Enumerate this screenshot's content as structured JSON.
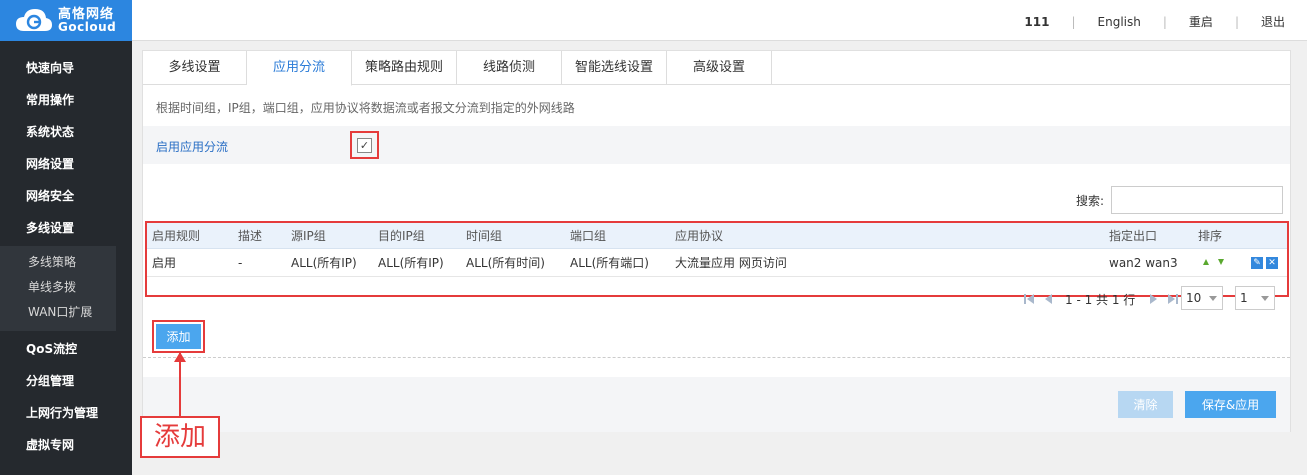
{
  "brand": {
    "name_cn": "高恪网络",
    "name_en": "Gocloud"
  },
  "topbar": {
    "user": "111",
    "language": "English",
    "reboot": "重启",
    "logout": "退出"
  },
  "sidebar": {
    "items": [
      {
        "label": "快速向导"
      },
      {
        "label": "常用操作"
      },
      {
        "label": "系统状态"
      },
      {
        "label": "网络设置"
      },
      {
        "label": "网络安全"
      },
      {
        "label": "多线设置"
      }
    ],
    "sub_items": [
      {
        "label": "多线策略"
      },
      {
        "label": "单线多拨"
      },
      {
        "label": "WAN口扩展"
      }
    ],
    "items_after": [
      {
        "label": "QoS流控"
      },
      {
        "label": "分组管理"
      },
      {
        "label": "上网行为管理"
      },
      {
        "label": "虚拟专网"
      }
    ]
  },
  "tabs": [
    {
      "label": "多线设置"
    },
    {
      "label": "应用分流"
    },
    {
      "label": "策略路由规则"
    },
    {
      "label": "线路侦测"
    },
    {
      "label": "智能选线设置"
    },
    {
      "label": "高级设置"
    }
  ],
  "description": "根据时间组，IP组，端口组，应用协议将数据流或者报文分流到指定的外网线路",
  "enable": {
    "label": "启用应用分流",
    "checked": true,
    "check_glyph": "✓"
  },
  "search": {
    "label": "搜索:",
    "value": ""
  },
  "table": {
    "headers": [
      "启用规则",
      "描述",
      "源IP组",
      "目的IP组",
      "时间组",
      "端口组",
      "应用协议",
      "指定出口",
      "排序"
    ],
    "rows": [
      {
        "enabled": "启用",
        "desc": "-",
        "src": "ALL(所有IP)",
        "dst": "ALL(所有IP)",
        "time": "ALL(所有时间)",
        "port": "ALL(所有端口)",
        "protocol": "大流量应用 网页访问",
        "outlet": "wan2 wan3"
      }
    ]
  },
  "pager": {
    "info": "1 - 1 共 1 行",
    "page_size": "10",
    "page": "1"
  },
  "buttons": {
    "add": "添加",
    "clear": "清除",
    "save": "保存&应用"
  },
  "annotation": {
    "text": "添加"
  },
  "colors": {
    "accent": "#2c86e0",
    "highlight": "#e53b3b",
    "button": "#4ba6ee"
  }
}
